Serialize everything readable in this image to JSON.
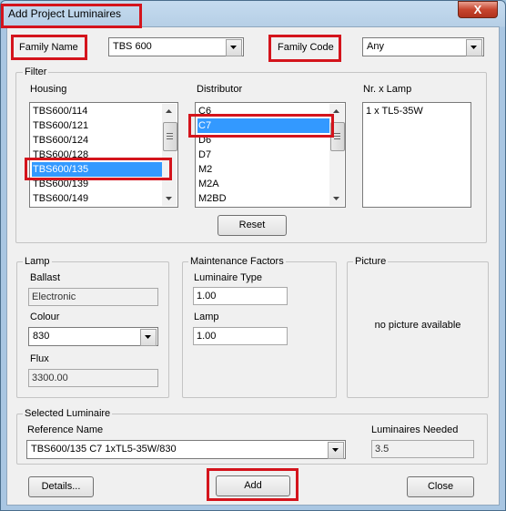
{
  "window": {
    "title": "Add Project Luminaires",
    "close_glyph": "X"
  },
  "header": {
    "family_name_label": "Family Name",
    "family_name_value": "TBS 600",
    "family_code_label": "Family Code",
    "family_code_value": "Any"
  },
  "filter": {
    "group_label": "Filter",
    "housing": {
      "label": "Housing",
      "items": [
        "TBS600/114",
        "TBS600/121",
        "TBS600/124",
        "TBS600/128",
        "TBS600/135",
        "TBS600/139",
        "TBS600/149"
      ],
      "selected": "TBS600/135"
    },
    "distributor": {
      "label": "Distributor",
      "items": [
        "C6",
        "C7",
        "D6",
        "D7",
        "M2",
        "M2A",
        "M2BD"
      ],
      "selected": "C7"
    },
    "lamp_count": {
      "label": "Nr. x Lamp",
      "items": [
        "1 x TL5-35W"
      ]
    },
    "reset_label": "Reset"
  },
  "lamp": {
    "group_label": "Lamp",
    "ballast_label": "Ballast",
    "ballast_value": "Electronic",
    "colour_label": "Colour",
    "colour_value": "830",
    "flux_label": "Flux",
    "flux_value": "3300.00"
  },
  "maintenance": {
    "group_label": "Maintenance Factors",
    "luminaire_type_label": "Luminaire Type",
    "luminaire_type_value": "1.00",
    "lamp_label": "Lamp",
    "lamp_value": "1.00"
  },
  "picture": {
    "group_label": "Picture",
    "placeholder": "no picture available"
  },
  "selected_luminaire": {
    "group_label": "Selected Luminaire",
    "reference_name_label": "Reference Name",
    "reference_name_value": "TBS600/135 C7 1xTL5-35W/830",
    "luminaires_needed_label": "Luminaires Needed",
    "luminaires_needed_value": "3.5"
  },
  "footer": {
    "details_label": "Details...",
    "add_label": "Add",
    "close_label": "Close"
  },
  "icons": {
    "dropdown": "chevron-down-icon",
    "scroll_up": "arrow-up-icon",
    "scroll_down": "arrow-down-icon"
  },
  "colors": {
    "highlight": "#d4141c",
    "selection": "#3399ff",
    "title_bar": "#b6cfe6",
    "close_button": "#c7452e"
  }
}
